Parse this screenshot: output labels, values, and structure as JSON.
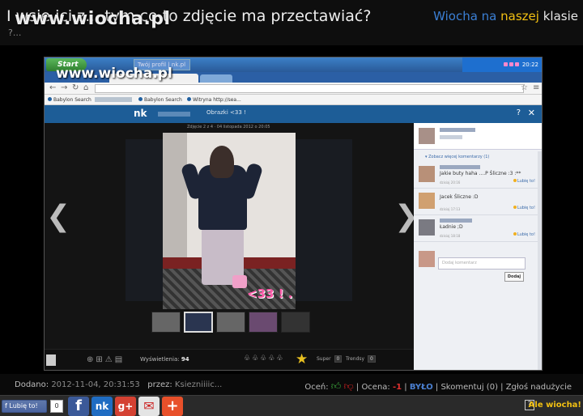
{
  "header": {
    "title": "I wsie ici z... tym co to zdjęcie ma przectawiać?",
    "subtitle": "?...",
    "watermark": "www.wiocha.pl",
    "brand": {
      "part1": "Wiocha na",
      "part2": "naszej",
      "part3": "klasie"
    },
    "colors": {
      "brand_blue": "#3b7fd4",
      "brand_yellow": "#f2c012"
    }
  },
  "screenshot": {
    "taskbar": {
      "start_label": "Start",
      "task_label": "Twój profil | nk.pl",
      "clock": "20:22"
    },
    "watermark": "www.wiocha.pl",
    "bookmarks": [
      {
        "label": "Babylon Search"
      },
      {
        "label": "Babylon Search"
      },
      {
        "label": "Witryna http://sea..."
      }
    ],
    "nk": {
      "logo": "nk",
      "tab_label": "Obrazki <33 !",
      "help": "?",
      "close": "✕"
    },
    "photo": {
      "caption": "Zdjęcie 2 z 4 · 04 listopada 2012 o 20:05",
      "overlay_text": "<33 ! .",
      "thumb_count": 5
    },
    "viewer_footer": {
      "views_label": "Wyświetlenia:",
      "views_value": "94",
      "super_label": "Super",
      "super_value": "0",
      "trend_label": "Trendsy",
      "trend_value": "0"
    },
    "sidebar": {
      "section_label": "▾ Zobacz więcej komentarzy (1)",
      "comments": [
        {
          "text": "Jakie buty haha ....P   Śliczne :3 :**",
          "meta": "dzisiaj 20:16",
          "like": "Lubię to!"
        },
        {
          "text": "Jacek   Śliczne :D",
          "meta": "dzisiaj 17:13",
          "like": "Lubię to!"
        },
        {
          "text": "Ładnie ;D",
          "meta": "dzisiaj 18:18",
          "like": "Lubię to!"
        }
      ],
      "reply_placeholder": "Dodaj komentarz",
      "reply_button": "Dodaj"
    }
  },
  "info": {
    "added_label": "Dodano:",
    "added_date": "2012-11-04, 20:31:53",
    "author_label": "przez:",
    "author": "Ksiezniiiic...",
    "rate_label": "Oceń:",
    "score_label": "Ocena:",
    "score": "-1",
    "bylo": "BYŁO",
    "comment_label": "Skomentuj (0)",
    "report_label": "Zgłoś nadużycie"
  },
  "social": {
    "like_label": "Lubię to!",
    "like_count": "0",
    "help": "?",
    "ale_wiocha": "Ale wiocha!"
  }
}
